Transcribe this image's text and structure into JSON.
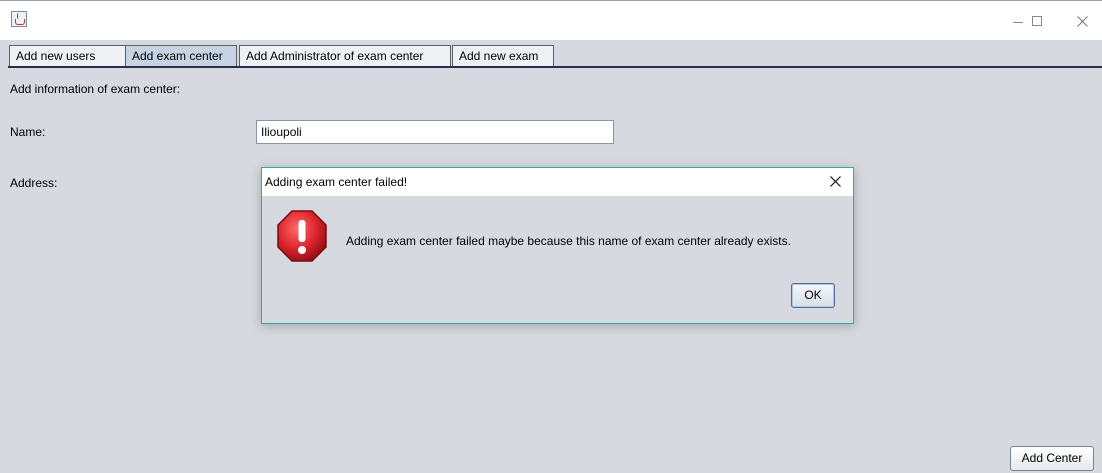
{
  "window": {
    "title": "",
    "controls": [
      "minimize",
      "maximize",
      "close"
    ]
  },
  "tabs": [
    {
      "label": "Add new users",
      "selected": false
    },
    {
      "label": "Add exam center",
      "selected": true
    },
    {
      "label": "Add Administrator of exam center",
      "selected": false
    },
    {
      "label": "Add new exam",
      "selected": false
    }
  ],
  "form": {
    "heading": "Add information of exam center:",
    "name_label": "Name:",
    "name_value": "Ilioupoli",
    "address_label": "Address:",
    "submit_label": "Add Center"
  },
  "dialog": {
    "title": "Adding exam center failed!",
    "message": "Adding exam center failed maybe because this name of exam center already exists.",
    "ok_label": "OK",
    "icon": "error-icon"
  },
  "colors": {
    "background": "#d6d9df",
    "selected_tab": "#c5d3e3",
    "dialog_border": "#2fae9c",
    "error_red": "#d8232a"
  }
}
